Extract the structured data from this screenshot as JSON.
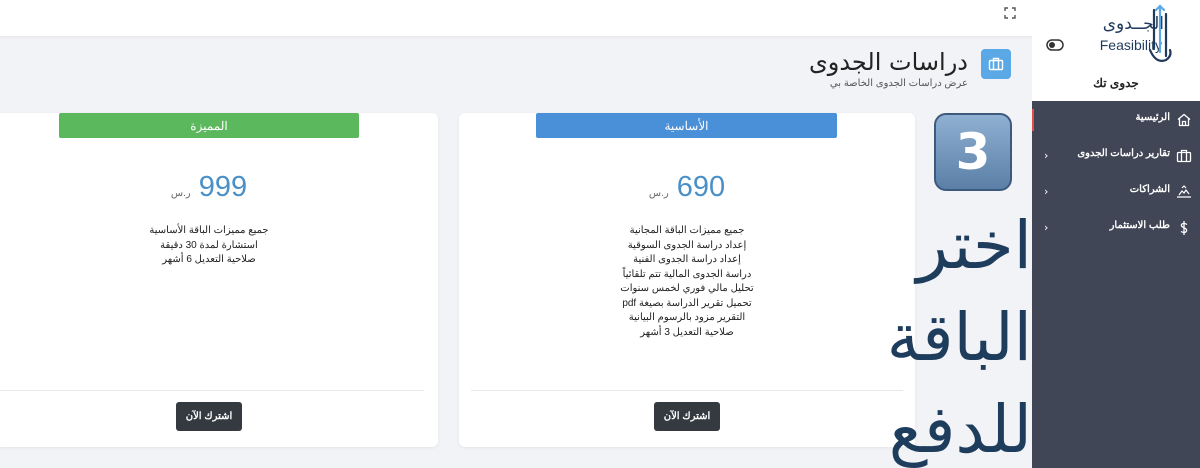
{
  "brand": {
    "logo_ar": "الجــدوى",
    "logo_en": "Feasibility",
    "name": "جدوى تك"
  },
  "sidebar": {
    "items": [
      {
        "label": "الرئيسية",
        "icon": "home-icon",
        "has_chevron": false,
        "active": true
      },
      {
        "label": "تقارير دراسات الجدوى",
        "icon": "briefcase-icon",
        "has_chevron": true,
        "active": false
      },
      {
        "label": "الشراكات",
        "icon": "handshake-icon",
        "has_chevron": true,
        "active": false
      },
      {
        "label": "طلب الاستثمار",
        "icon": "dollar-icon",
        "has_chevron": true,
        "active": false
      }
    ]
  },
  "page": {
    "title": "دراسات الجدوى",
    "subtitle": "عرض دراسات الجدوى الخاصة بي",
    "title_icon": "briefcase-icon"
  },
  "plans": [
    {
      "name": "الأساسية",
      "price": "690",
      "currency": "ر.س",
      "color": "#4a90d9",
      "features": [
        "جميع مميزات الباقة المجانية",
        "إعداد دراسة الجدوى السوقية",
        "إعداد دراسة الجدوى الفنية",
        "دراسة الجدوى المالية تتم تلقائياً",
        "تحليل مالي فوري لخمس سنوات",
        "تحميل تقرير الدراسة بصيغة pdf",
        "التقرير مزود بالرسوم البيانية",
        "صلاحية التعديل 3 أشهر"
      ],
      "button": "اشترك الآن"
    },
    {
      "name": "المميزة",
      "price": "999",
      "currency": "ر.س",
      "color": "#5cb85c",
      "features": [
        "جميع مميزات الباقة الأساسية",
        "استشارة لمدة 30 دقيقة",
        "صلاحية التعديل 6 أشهر"
      ],
      "button": "اشترك الآن"
    }
  ],
  "overlay": {
    "step_number": "3",
    "instruction_lines": [
      "اختر",
      "الباقة",
      "للدفع"
    ]
  }
}
